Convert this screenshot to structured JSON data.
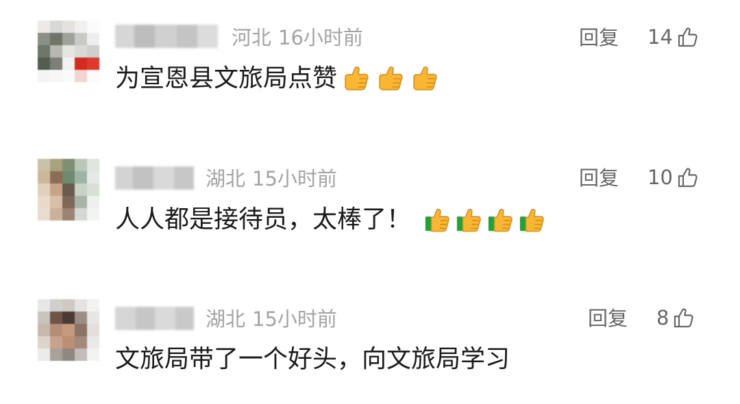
{
  "comments": [
    {
      "location": "河北",
      "time": "16小时前",
      "reply_label": "回复",
      "like_count": "14",
      "text": "为宣恩县文旅局点赞",
      "emoji": [
        "thumbs-up",
        "thumbs-up",
        "thumbs-up"
      ]
    },
    {
      "location": "湖北",
      "time": "15小时前",
      "reply_label": "回复",
      "like_count": "10",
      "text": "人人都是接待员，太棒了！",
      "emoji": [
        "thumbs-up-green-sleeve",
        "thumbs-up-green-sleeve",
        "thumbs-up-green-sleeve",
        "thumbs-up-green-sleeve"
      ]
    },
    {
      "location": "湖北",
      "time": "15小时前",
      "reply_label": "回复",
      "like_count": "8",
      "text": "文旅局带了一个好头，向文旅局学习",
      "emoji": []
    }
  ],
  "colors": {
    "text": "#1a1a1a",
    "meta": "#a3a3a3",
    "action": "#666666",
    "emoji_yellow": "#f7b733",
    "emoji_sleeve": "#1fa33b"
  }
}
